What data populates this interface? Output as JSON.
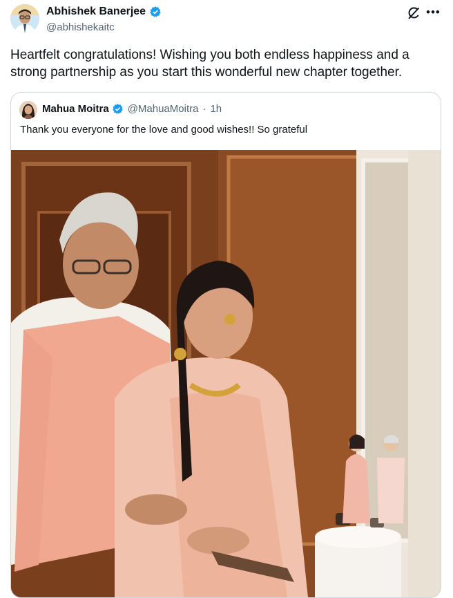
{
  "author": {
    "name": "Abhishek Banerjee",
    "handle": "@abhishekaitc",
    "verified": true
  },
  "tweet": {
    "text": "Heartfelt congratulations! Wishing you both endless happiness and a strong partnership as you start this wonderful new chapter together."
  },
  "quoted": {
    "name": "Mahua Moitra",
    "handle": "@MahuaMoitra",
    "separator": "·",
    "time": "1h",
    "text": "Thank you everyone for the love and good wishes!! So grateful",
    "image_icon": "wedding-photo"
  },
  "icons": {
    "verified": "verified-badge-icon",
    "grok": "grok-icon",
    "more": "more-icon"
  },
  "colors": {
    "verified": "#1d9bf0",
    "text": "#0f1419",
    "secondary": "#536471",
    "border": "#cfd9de"
  }
}
